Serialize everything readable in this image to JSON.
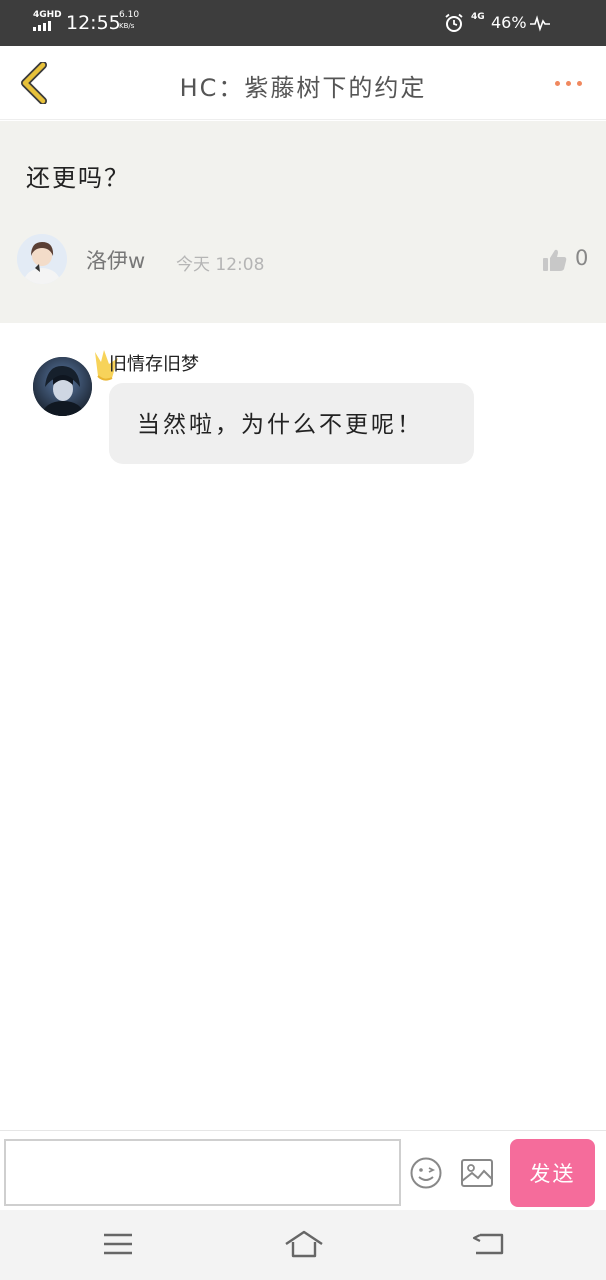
{
  "status_bar": {
    "network": "4GHD",
    "time": "12:55",
    "speed_value": "6.10",
    "speed_unit": "KB/s",
    "network_2": "4G",
    "battery": "46%"
  },
  "header": {
    "title": "HC：紫藤树下的约定"
  },
  "post": {
    "content": "还更吗？",
    "author": "洛伊w",
    "time": "今天 12:08",
    "likes": "0"
  },
  "reply": {
    "author": "旧情存旧梦",
    "text": "当然啦，为什么不更呢！"
  },
  "input": {
    "placeholder": "",
    "send_label": "发送"
  },
  "colors": {
    "accent": "#f56c9b",
    "back_arrow": "#e7c13a",
    "more_dots": "#f0885e",
    "post_bg": "#f2f2ee"
  },
  "icons": {
    "back": "chevron-left-icon",
    "more": "more-dots-icon",
    "like": "thumbs-up-icon",
    "crown": "crown-icon",
    "emoji": "emoji-icon",
    "image": "image-icon"
  }
}
